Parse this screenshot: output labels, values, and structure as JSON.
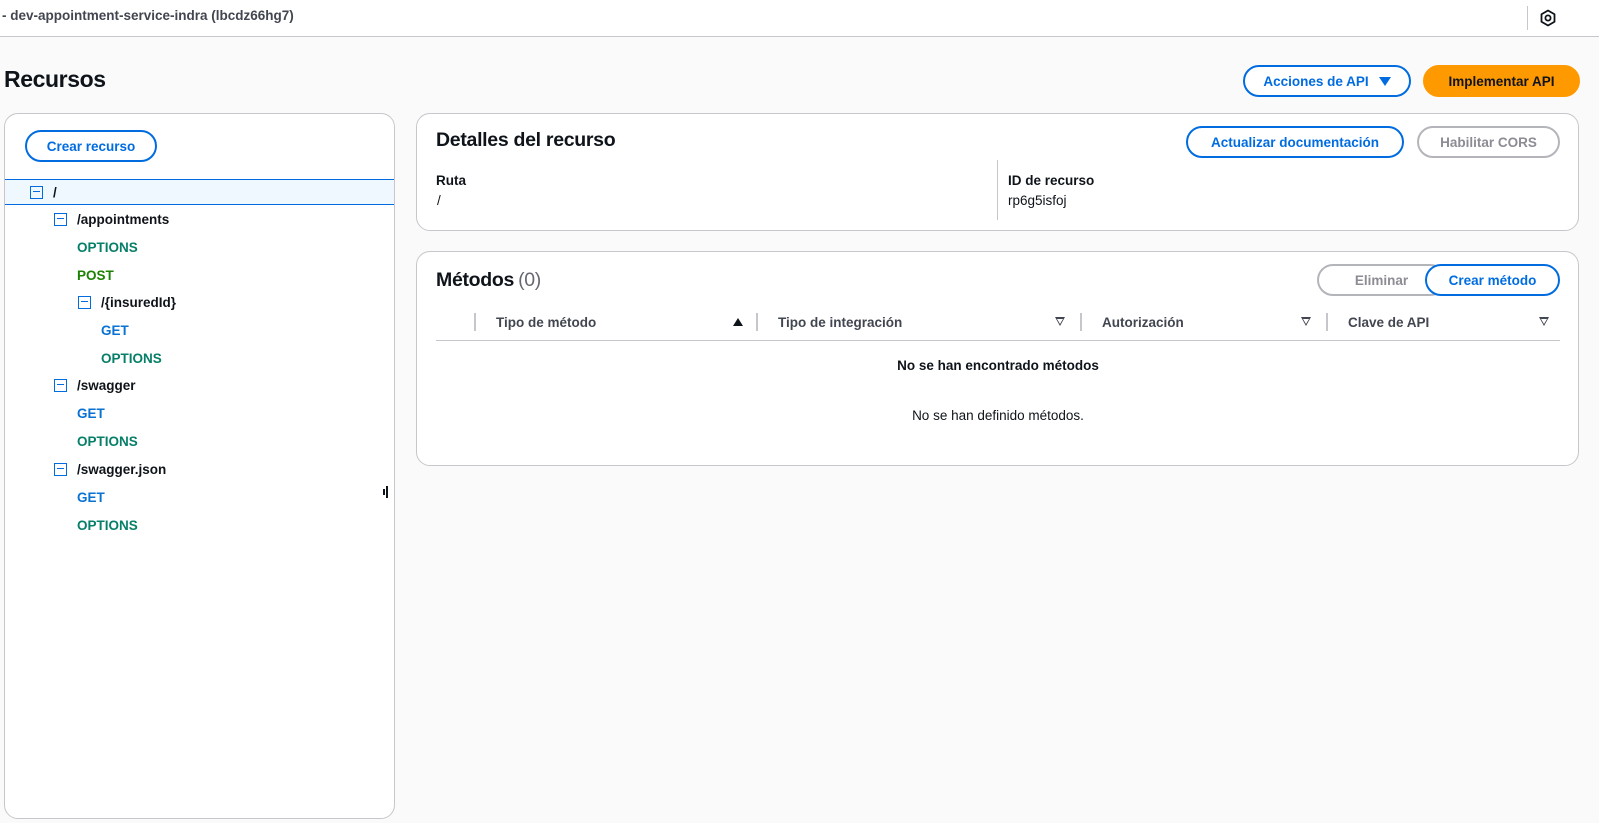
{
  "header": {
    "breadcrumb": "- dev-appointment-service-indra (lbcdz66hg7)"
  },
  "page": {
    "title": "Recursos",
    "actions_button": "Acciones de API",
    "deploy_button": "Implementar API"
  },
  "resources_panel": {
    "create_button": "Crear recurso",
    "tree": {
      "root": "/",
      "appointments": "/appointments",
      "appointments_options": "OPTIONS",
      "appointments_post": "POST",
      "insured": "/{insuredId}",
      "insured_get": "GET",
      "insured_options": "OPTIONS",
      "swagger": "/swagger",
      "swagger_get": "GET",
      "swagger_options": "OPTIONS",
      "swagger_json": "/swagger.json",
      "swagger_json_get": "GET",
      "swagger_json_options": "OPTIONS"
    }
  },
  "resource_details": {
    "title": "Detalles del recurso",
    "update_docs_button": "Actualizar documentación",
    "cors_button": "Habilitar CORS",
    "path_label": "Ruta",
    "path_value": "/",
    "id_label": "ID de recurso",
    "id_value": "rp6g5isfoj"
  },
  "methods": {
    "title": "Métodos",
    "count": "(0)",
    "delete_button": "Eliminar",
    "create_button": "Crear método",
    "columns": {
      "method_type": "Tipo de método",
      "integration_type": "Tipo de integración",
      "authorization": "Autorización",
      "api_key": "Clave de API"
    },
    "empty_title": "No se han encontrado métodos",
    "empty_subtitle": "No se han definido métodos."
  },
  "colors": {
    "accent": "#006ce0",
    "primary_button": "#ff9900",
    "method_options": "#067f68",
    "method_post": "#1d8102",
    "method_get": "#0972d3"
  }
}
